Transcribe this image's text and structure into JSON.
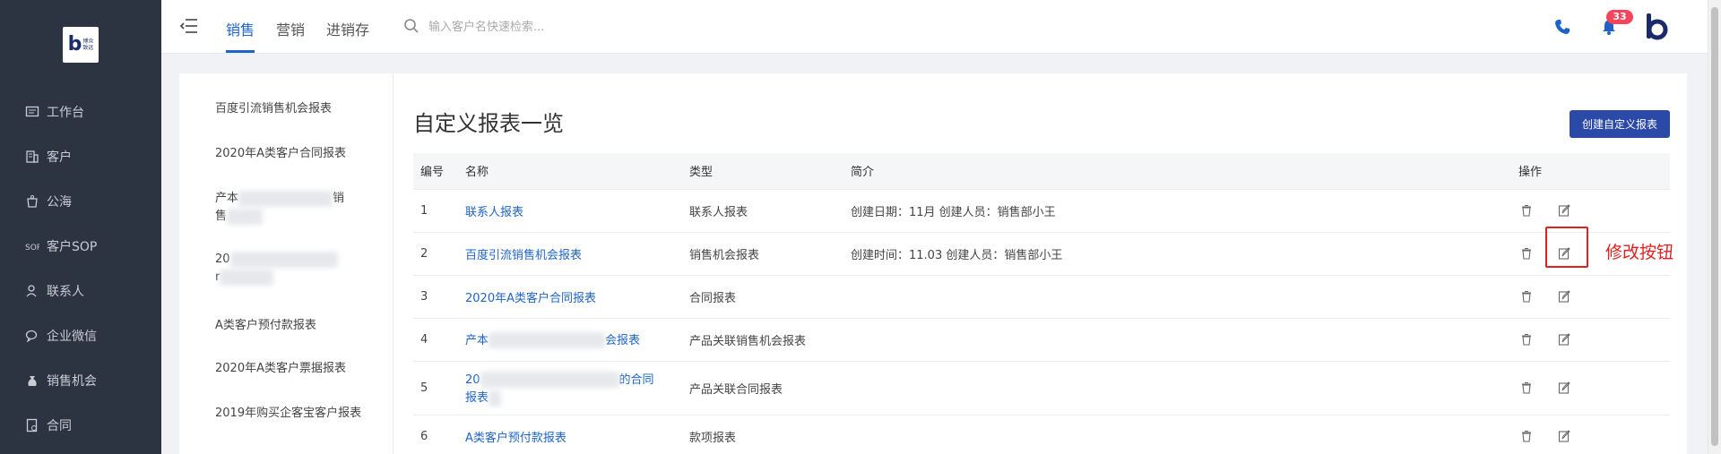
{
  "sidebar": {
    "logo_small_text": "博众\n致远",
    "items": [
      {
        "label": "工作台",
        "icon": "dashboard-icon"
      },
      {
        "label": "客户",
        "icon": "building-icon"
      },
      {
        "label": "公海",
        "icon": "pool-icon"
      },
      {
        "label": "客户SOP",
        "icon": "sop-icon"
      },
      {
        "label": "联系人",
        "icon": "contact-icon"
      },
      {
        "label": "企业微信",
        "icon": "wechat-icon"
      },
      {
        "label": "销售机会",
        "icon": "moneybag-icon"
      },
      {
        "label": "合同",
        "icon": "contract-icon"
      }
    ]
  },
  "topbar": {
    "tabs": [
      {
        "label": "销售",
        "active": true
      },
      {
        "label": "营销",
        "active": false
      },
      {
        "label": "进销存",
        "active": false
      }
    ],
    "search_placeholder": "输入客户名快速检索...",
    "notification_count": "33"
  },
  "report_list": {
    "items": [
      {
        "label": "百度引流销售机会报表"
      },
      {
        "label": "2020年A类客户合同报表"
      },
      {
        "label_start": "产本",
        "label_end": "销",
        "label_line2": "售",
        "obscured": true
      },
      {
        "label_start": "20",
        "label_line2": "r",
        "obscured": true
      },
      {
        "label": "A类客户预付款报表"
      },
      {
        "label": "2020年A类客户票据报表"
      },
      {
        "label": "2019年购买企客宝客户报表"
      }
    ]
  },
  "main": {
    "title": "自定义报表一览",
    "create_button": "创建自定义报表",
    "columns": {
      "id": "编号",
      "name": "名称",
      "type": "类型",
      "desc": "简介",
      "ops": "操作"
    },
    "rows": [
      {
        "id": "1",
        "name": "联系人报表",
        "type": "联系人报表",
        "desc": "创建日期：11月 创建人员：销售部小王"
      },
      {
        "id": "2",
        "name": "百度引流销售机会报表",
        "type": "销售机会报表",
        "desc": "创建时间：11.03 创建人员：销售部小王"
      },
      {
        "id": "3",
        "name": "2020年A类客户合同报表",
        "type": "合同报表",
        "desc": ""
      },
      {
        "id": "4",
        "name_start": "产本",
        "name_end": "会报表",
        "type": "产品关联销售机会报表",
        "desc": ""
      },
      {
        "id": "5",
        "name_start": "20",
        "name_end": "的合同",
        "name_line2": "报表",
        "type": "产品关联合同报表",
        "desc": ""
      },
      {
        "id": "6",
        "name": "A类客户预付款报表",
        "type": "款项报表",
        "desc": ""
      }
    ],
    "annotation": "修改按钮"
  },
  "colors": {
    "sidebar_bg": "#2d3441",
    "accent": "#1e64c8",
    "button_bg": "#2b4aa8",
    "badge": "#f5455d",
    "annotation": "#e02020"
  }
}
